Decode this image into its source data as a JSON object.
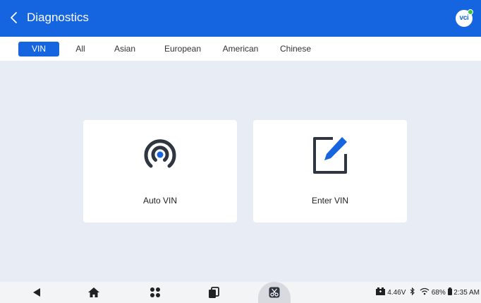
{
  "header": {
    "title": "Diagnostics",
    "vci_label": "vci"
  },
  "tabs": [
    {
      "label": "VIN",
      "active": true
    },
    {
      "label": "All",
      "active": false
    },
    {
      "label": "Asian",
      "active": false
    },
    {
      "label": "European",
      "active": false
    },
    {
      "label": "American",
      "active": false
    },
    {
      "label": "Chinese",
      "active": false
    }
  ],
  "cards": [
    {
      "label": "Auto VIN",
      "icon": "wireless-signal-icon"
    },
    {
      "label": "Enter VIN",
      "icon": "edit-icon"
    }
  ],
  "statusbar": {
    "voltage": "4.46V",
    "battery": "68%",
    "time": "2:35 AM"
  },
  "colors": {
    "accent": "#1565e0",
    "background": "#e8ecf5",
    "card": "#ffffff",
    "icon_dark": "#2f3640"
  }
}
